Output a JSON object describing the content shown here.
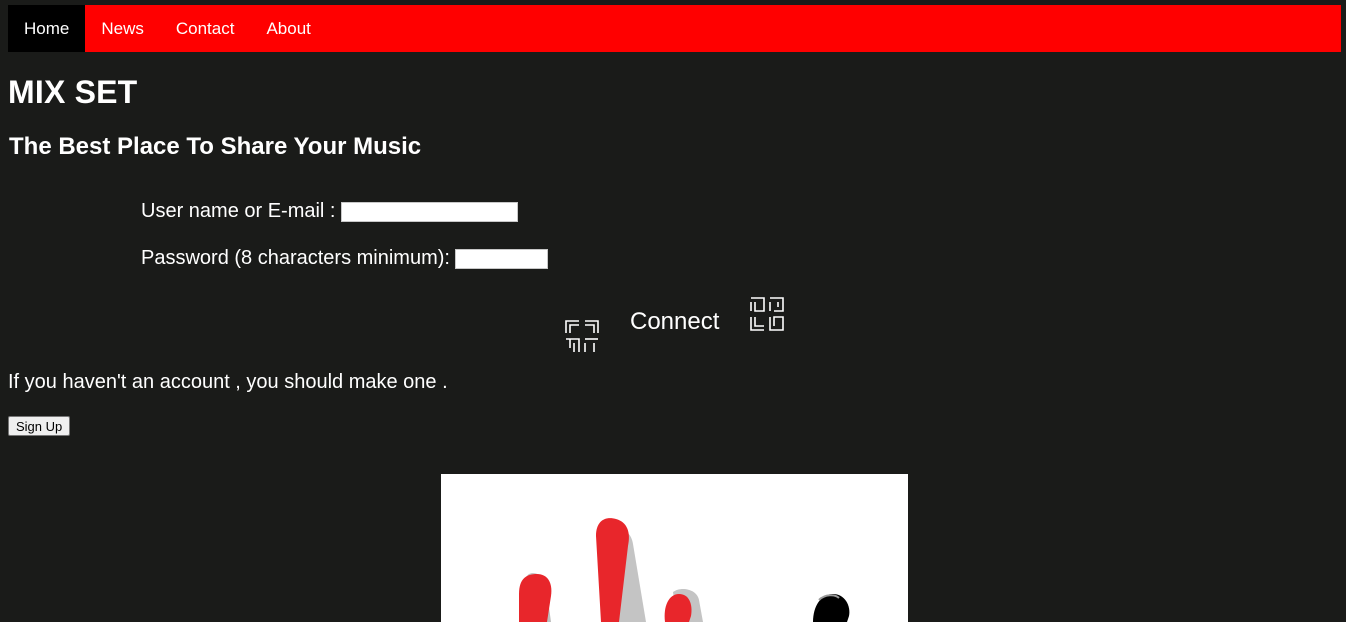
{
  "nav": {
    "items": [
      {
        "label": "Home",
        "active": true
      },
      {
        "label": "News",
        "active": false
      },
      {
        "label": "Contact",
        "active": false
      },
      {
        "label": "About",
        "active": false
      }
    ],
    "background": "#ff0000",
    "active_background": "#000000"
  },
  "header": {
    "title": "MIX SET",
    "subtitle": "The Best Place To Share Your Music"
  },
  "form": {
    "username_label": "User name or E-mail :",
    "username_value": "",
    "password_label": "Password (8 characters minimum):",
    "password_value": "",
    "connect_label": "Connect",
    "icons": [
      "quadrant-corners-icon",
      "quadrant-corners-icon"
    ]
  },
  "account": {
    "text": "If you haven't an account , you should make one .",
    "signup_label": "Sign Up"
  },
  "logo": {
    "alt": "mix set logo",
    "colors": {
      "red": "#e8262b",
      "black": "#000000"
    }
  },
  "colors": {
    "page_background": "#1a1b19",
    "text": "#ffffff"
  }
}
